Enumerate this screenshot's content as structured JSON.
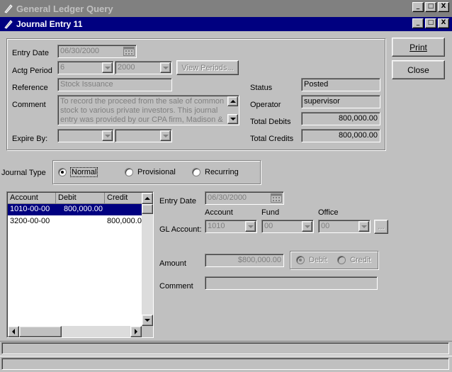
{
  "window": {
    "title": "General Ledger Query",
    "child_title": "Journal Entry 11",
    "min_glyph": "_",
    "max_glyph": "□",
    "close_glyph": "X"
  },
  "header": {
    "entry_date_label": "Entry Date",
    "entry_date_value": "06/30/2000",
    "actg_period_label": "Actg Period",
    "period_value": "6",
    "year_value": "2000",
    "view_periods_label": "View Periods...",
    "reference_label": "Reference",
    "reference_value": "Stock Issuance",
    "comment_label": "Comment",
    "comment_value": "To record the proceed from the sale of common stock to various private investors.  This journal entry was provided by our CPA firm, Madison &",
    "expire_by_label": "Expire By:",
    "expire_value_1": "",
    "expire_value_2": "",
    "status_label": "Status",
    "status_value": "Posted",
    "operator_label": "Operator",
    "operator_value": "supervisor",
    "total_debits_label": "Total Debits",
    "total_debits_value": "800,000.00",
    "total_credits_label": "Total Credits",
    "total_credits_value": "800,000.00"
  },
  "buttons": {
    "print": "Print",
    "close": "Close"
  },
  "journal_type": {
    "label": "Journal Type",
    "options": [
      "Normal",
      "Provisional",
      "Recurring"
    ],
    "selected": "Normal"
  },
  "grid": {
    "columns": [
      "Account",
      "Debit",
      "Credit"
    ],
    "rows": [
      {
        "account": "1010-00-00",
        "debit": "800,000.00",
        "credit": ""
      },
      {
        "account": "3200-00-00",
        "debit": "",
        "credit": "800,000.0"
      }
    ],
    "selected_row": 0
  },
  "detail": {
    "entry_date_label": "Entry Date",
    "entry_date_value": "06/30/2000",
    "account_col_label": "Account",
    "fund_col_label": "Fund",
    "office_col_label": "Office",
    "gl_account_label": "GL Account:",
    "account_value": "1010",
    "fund_value": "00",
    "office_value": "00",
    "lookup_label": "...",
    "amount_label": "Amount",
    "amount_value": "$800,000.00",
    "debit_label": "Debit",
    "credit_label": "Credit",
    "comment_label": "Comment",
    "comment_value": ""
  },
  "status_bar": {
    "text": ""
  },
  "icons": {
    "app": "pen-icon",
    "calendar": "calendar-icon"
  }
}
